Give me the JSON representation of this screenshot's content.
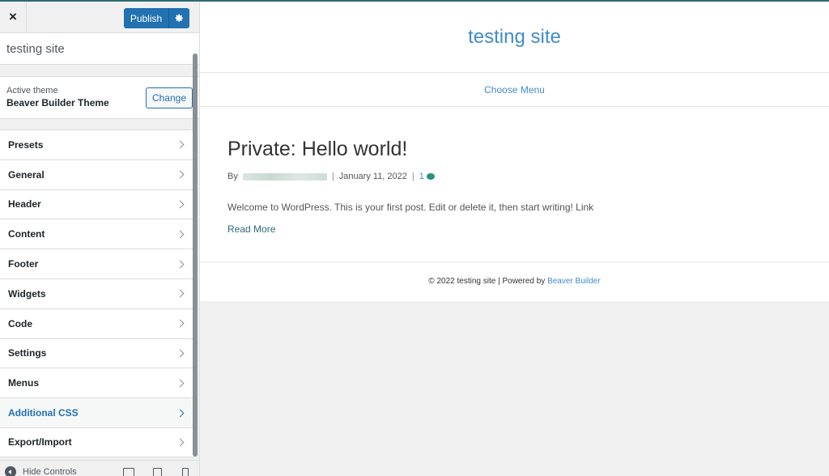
{
  "header": {
    "close_icon": "×",
    "publish_label": "Publish",
    "settings_icon": "gear-icon"
  },
  "site_name": "testing site",
  "theme": {
    "label": "Active theme",
    "name": "Beaver Builder Theme",
    "change_label": "Change"
  },
  "menu": {
    "items": [
      {
        "label": "Presets"
      },
      {
        "label": "General"
      },
      {
        "label": "Header"
      },
      {
        "label": "Content"
      },
      {
        "label": "Footer"
      },
      {
        "label": "Widgets"
      },
      {
        "label": "Code"
      },
      {
        "label": "Settings"
      },
      {
        "label": "Menus"
      },
      {
        "label": "Additional CSS",
        "active": true
      },
      {
        "label": "Export/Import"
      }
    ]
  },
  "footer_controls": {
    "hide_label": "Hide Controls"
  },
  "preview": {
    "site_title": "testing site",
    "nav_label": "Choose Menu",
    "post": {
      "title": "Private: Hello world!",
      "by": "By",
      "sep": "|",
      "date": "January 11, 2022",
      "comments": "1",
      "excerpt": "Welcome to WordPress. This is your first post. Edit or delete it, then start writing! Link",
      "read_more": "Read More"
    },
    "footer": {
      "text": "© 2022 testing site | Powered by ",
      "link": "Beaver Builder"
    }
  },
  "colors": {
    "accent": "#2271b1",
    "link": "#428bca",
    "teal": "#2c6b74"
  }
}
